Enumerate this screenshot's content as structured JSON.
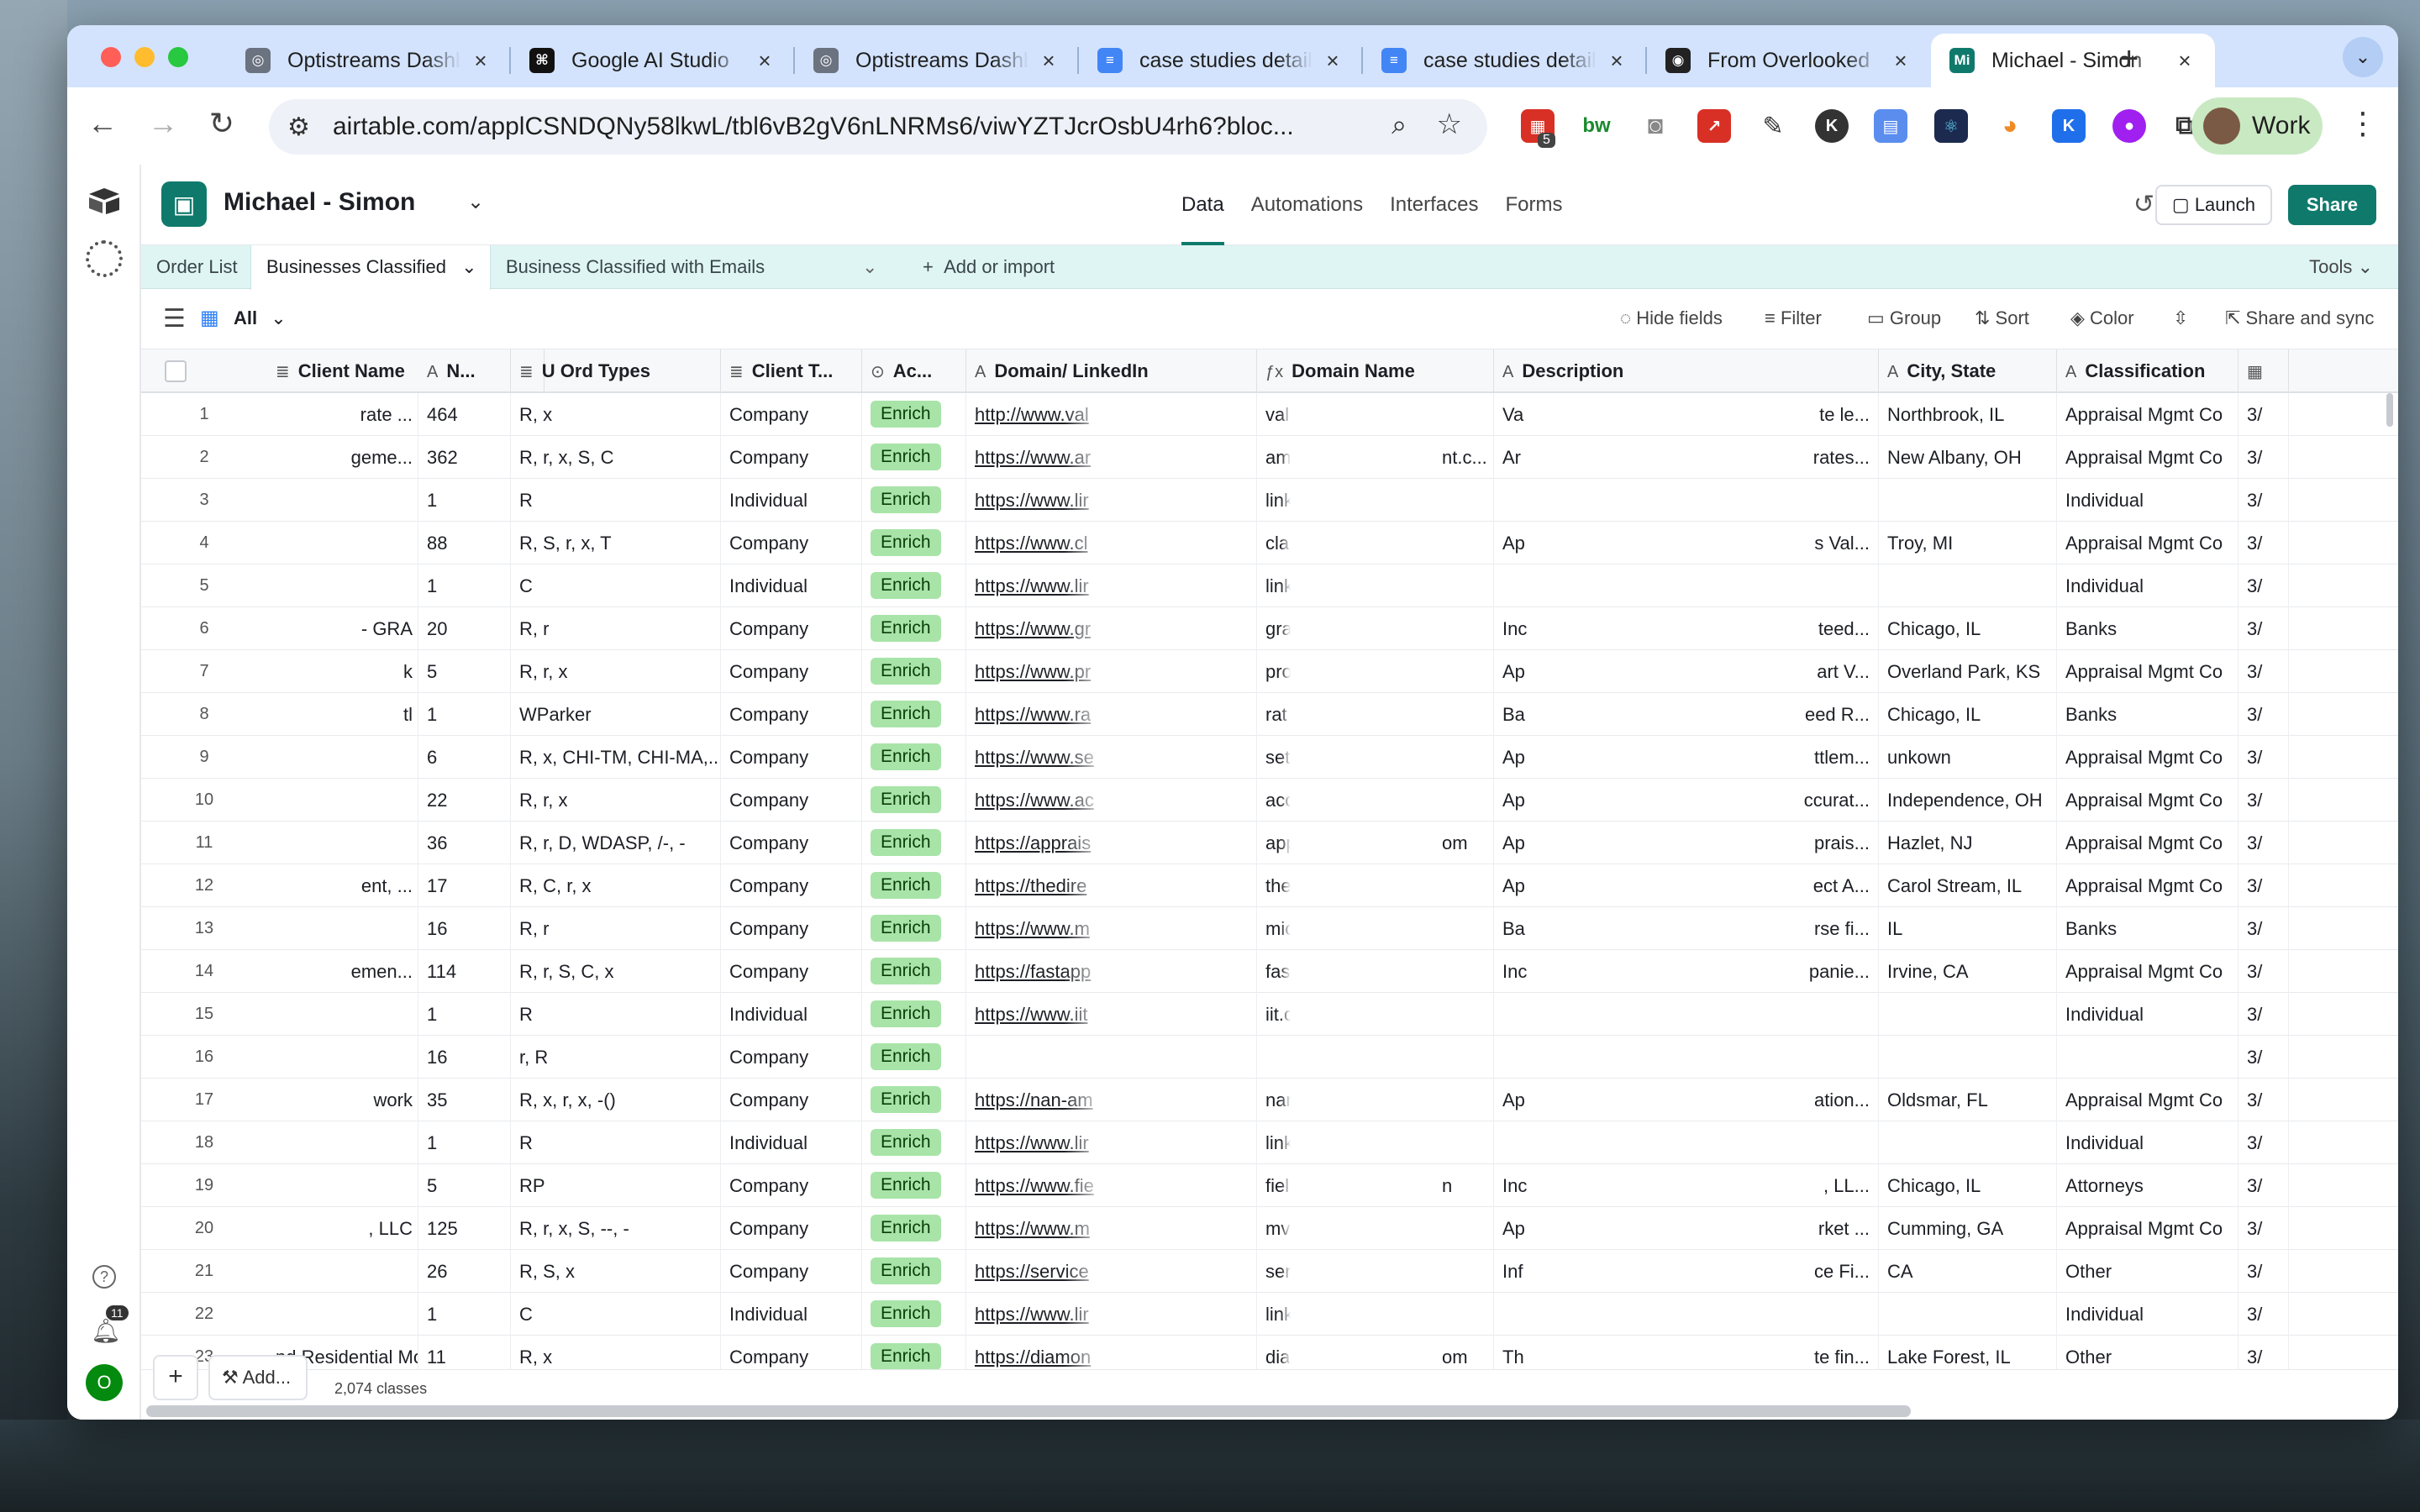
{
  "browser": {
    "tabs": [
      {
        "title": "Optistreams Dashboard",
        "favicon": "globe-icon",
        "color": "#6b7280"
      },
      {
        "title": "Google AI Studio",
        "favicon": "ai-studio-icon",
        "color": "#111111"
      },
      {
        "title": "Optistreams Dashboard",
        "favicon": "globe-icon",
        "color": "#6b7280"
      },
      {
        "title": "case studies details",
        "favicon": "docs-icon",
        "color": "#4285f4"
      },
      {
        "title": "case studies details",
        "favicon": "docs-icon",
        "color": "#4285f4"
      },
      {
        "title": "From Overlooked",
        "favicon": "podcast-icon",
        "color": "#222222"
      },
      {
        "title": "Michael - Simon",
        "favicon": "Mi",
        "color": "#0f7a6c"
      }
    ],
    "url": "airtable.com/applCSNDQNy58lkwL/tbl6vB2gV6nLNRMs6/viwYZTJcrOsbU4rh6?bloc...",
    "extension_badge": "5",
    "profile_label": "Work"
  },
  "app": {
    "base_name": "Michael - Simon",
    "nav": [
      "Data",
      "Automations",
      "Interfaces",
      "Forms"
    ],
    "launch_label": "Launch",
    "share_label": "Share",
    "table_tabs": [
      "Order List",
      "Businesses Classified",
      "Business Classified with Emails"
    ],
    "add_import_label": "Add or import",
    "tools_label": "Tools",
    "view_name": "All",
    "view_actions": [
      "Hide fields",
      "Filter",
      "Group",
      "Sort",
      "Color",
      "Share and sync"
    ],
    "notification_count": "11",
    "avatar_letter": "O"
  },
  "grid": {
    "columns": [
      "Client Name",
      "N...",
      "U Ord Types",
      "Client T...",
      "Ac...",
      "Domain/ LinkedIn",
      "Domain Name",
      "Description",
      "City, State",
      "Classification"
    ],
    "rows": [
      {
        "n": "1",
        "client": "rate ...",
        "num": "464",
        "types": "R, x",
        "ctype": "Company",
        "ac": "Enrich",
        "domain": "http://www.val",
        "dname": "val",
        "dname2": "",
        "desc": "Va",
        "desc2": "te le...",
        "city": "Northbrook, IL",
        "cls": "Appraisal Mgmt Co"
      },
      {
        "n": "2",
        "client": "geme...",
        "num": "362",
        "types": "R, r, x, S, C",
        "ctype": "Company",
        "ac": "Enrich",
        "domain": "https://www.ar",
        "dname": "am",
        "dname2": "nt.c...",
        "desc": "Ar",
        "desc2": "rates...",
        "city": "New Albany, OH",
        "cls": "Appraisal Mgmt Co"
      },
      {
        "n": "3",
        "client": "",
        "num": "1",
        "types": "R",
        "ctype": "Individual",
        "ac": "Enrich",
        "domain": "https://www.lir",
        "dname": "link",
        "dname2": "",
        "desc": "",
        "desc2": "",
        "city": "",
        "cls": "Individual"
      },
      {
        "n": "4",
        "client": "",
        "num": "88",
        "types": "R, S, r, x, T",
        "ctype": "Company",
        "ac": "Enrich",
        "domain": "https://www.cl",
        "dname": "cla",
        "dname2": "",
        "desc": "Ap",
        "desc2": "s Val...",
        "city": "Troy, MI",
        "cls": "Appraisal Mgmt Co"
      },
      {
        "n": "5",
        "client": "",
        "num": "1",
        "types": "C",
        "ctype": "Individual",
        "ac": "Enrich",
        "domain": "https://www.lir",
        "dname": "link",
        "dname2": "",
        "desc": "",
        "desc2": "",
        "city": "",
        "cls": "Individual"
      },
      {
        "n": "6",
        "client": "- GRA",
        "num": "20",
        "types": "R, r",
        "ctype": "Company",
        "ac": "Enrich",
        "domain": "https://www.gr",
        "dname": "gra",
        "dname2": "",
        "desc": "Inc",
        "desc2": "teed...",
        "city": "Chicago, IL",
        "cls": "Banks"
      },
      {
        "n": "7",
        "client": "k",
        "num": "5",
        "types": "R, r, x",
        "ctype": "Company",
        "ac": "Enrich",
        "domain": "https://www.pr",
        "dname": "pro",
        "dname2": "",
        "desc": "Ap",
        "desc2": "art V...",
        "city": "Overland Park, KS",
        "cls": "Appraisal Mgmt Co"
      },
      {
        "n": "8",
        "client": "tl",
        "num": "1",
        "types": "WParker",
        "ctype": "Company",
        "ac": "Enrich",
        "domain": "https://www.ra",
        "dname": "rat",
        "dname2": "",
        "desc": "Ba",
        "desc2": "eed R...",
        "city": "Chicago, IL",
        "cls": "Banks"
      },
      {
        "n": "9",
        "client": "",
        "num": "6",
        "types": "R, x, CHI-TM, CHI-MA,...",
        "ctype": "Company",
        "ac": "Enrich",
        "domain": "https://www.se",
        "dname": "set",
        "dname2": "",
        "desc": "Ap",
        "desc2": "ttlem...",
        "city": "unkown",
        "cls": "Appraisal Mgmt Co"
      },
      {
        "n": "10",
        "client": "",
        "num": "22",
        "types": "R, r, x",
        "ctype": "Company",
        "ac": "Enrich",
        "domain": "https://www.ac",
        "dname": "acc",
        "dname2": "",
        "desc": "Ap",
        "desc2": "ccurat...",
        "city": "Independence, OH",
        "cls": "Appraisal Mgmt Co"
      },
      {
        "n": "11",
        "client": "",
        "num": "36",
        "types": "R, r, D, WDASP, /-, -",
        "ctype": "Company",
        "ac": "Enrich",
        "domain": "https://apprais",
        "dname": "app",
        "dname2": "om",
        "desc": "Ap",
        "desc2": "prais...",
        "city": "Hazlet, NJ",
        "cls": "Appraisal Mgmt Co"
      },
      {
        "n": "12",
        "client": "ent, ...",
        "num": "17",
        "types": "R, C, r, x",
        "ctype": "Company",
        "ac": "Enrich",
        "domain": "https://thedire",
        "dname": "the",
        "dname2": "",
        "desc": "Ap",
        "desc2": "ect A...",
        "city": "Carol Stream, IL",
        "cls": "Appraisal Mgmt Co"
      },
      {
        "n": "13",
        "client": "",
        "num": "16",
        "types": "R, r",
        "ctype": "Company",
        "ac": "Enrich",
        "domain": "https://www.m",
        "dname": "mic",
        "dname2": "",
        "desc": "Ba",
        "desc2": "rse fi...",
        "city": "IL",
        "cls": "Banks"
      },
      {
        "n": "14",
        "client": "emen...",
        "num": "114",
        "types": "R, r, S, C, x",
        "ctype": "Company",
        "ac": "Enrich",
        "domain": "https://fastapp",
        "dname": "fas",
        "dname2": "",
        "desc": "Inc",
        "desc2": "panie...",
        "city": "Irvine, CA",
        "cls": "Appraisal Mgmt Co"
      },
      {
        "n": "15",
        "client": "",
        "num": "1",
        "types": "R",
        "ctype": "Individual",
        "ac": "Enrich",
        "domain": "https://www.iit",
        "dname": "iit.c",
        "dname2": "",
        "desc": "",
        "desc2": "",
        "city": "",
        "cls": "Individual"
      },
      {
        "n": "16",
        "client": "",
        "num": "16",
        "types": "r, R",
        "ctype": "Company",
        "ac": "Enrich",
        "domain": "",
        "dname": "",
        "dname2": "",
        "desc": "",
        "desc2": "",
        "city": "",
        "cls": ""
      },
      {
        "n": "17",
        "client": "work",
        "num": "35",
        "types": "R, x, r, x, -()",
        "ctype": "Company",
        "ac": "Enrich",
        "domain": "https://nan-am",
        "dname": "nar",
        "dname2": "",
        "desc": "Ap",
        "desc2": "ation...",
        "city": "Oldsmar, FL",
        "cls": "Appraisal Mgmt Co"
      },
      {
        "n": "18",
        "client": "",
        "num": "1",
        "types": "R",
        "ctype": "Individual",
        "ac": "Enrich",
        "domain": "https://www.lir",
        "dname": "link",
        "dname2": "",
        "desc": "",
        "desc2": "",
        "city": "",
        "cls": "Individual"
      },
      {
        "n": "19",
        "client": "",
        "num": "5",
        "types": "RP",
        "ctype": "Company",
        "ac": "Enrich",
        "domain": "https://www.fie",
        "dname": "fiel",
        "dname2": "n",
        "desc": "Inc",
        "desc2": ", LL...",
        "city": "Chicago, IL",
        "cls": "Attorneys"
      },
      {
        "n": "20",
        "client": ", LLC",
        "num": "125",
        "types": "R, r, x, S, --, -",
        "ctype": "Company",
        "ac": "Enrich",
        "domain": "https://www.m",
        "dname": "mv",
        "dname2": "",
        "desc": "Ap",
        "desc2": "rket ...",
        "city": "Cumming, GA",
        "cls": "Appraisal Mgmt Co"
      },
      {
        "n": "21",
        "client": "",
        "num": "26",
        "types": "R, S, x",
        "ctype": "Company",
        "ac": "Enrich",
        "domain": "https://service",
        "dname": "ser",
        "dname2": "",
        "desc": "Inf",
        "desc2": "ce Fi...",
        "city": "CA",
        "cls": "Other"
      },
      {
        "n": "22",
        "client": "",
        "num": "1",
        "types": "C",
        "ctype": "Individual",
        "ac": "Enrich",
        "domain": "https://www.lir",
        "dname": "link",
        "dname2": "",
        "desc": "",
        "desc2": "",
        "city": "",
        "cls": "Individual"
      },
      {
        "n": "23",
        "client": "nd Residential Mortgage-...",
        "num": "11",
        "types": "R, x",
        "ctype": "Company",
        "ac": "Enrich",
        "domain": "https://diamon",
        "dname": "dia",
        "dname2": "om",
        "desc": "Th",
        "desc2": "te fin...",
        "city": "Lake Forest, IL",
        "cls": "Other"
      }
    ],
    "extra_col_text": "3/",
    "record_count": "2,074 classes",
    "add_label": "Add..."
  }
}
